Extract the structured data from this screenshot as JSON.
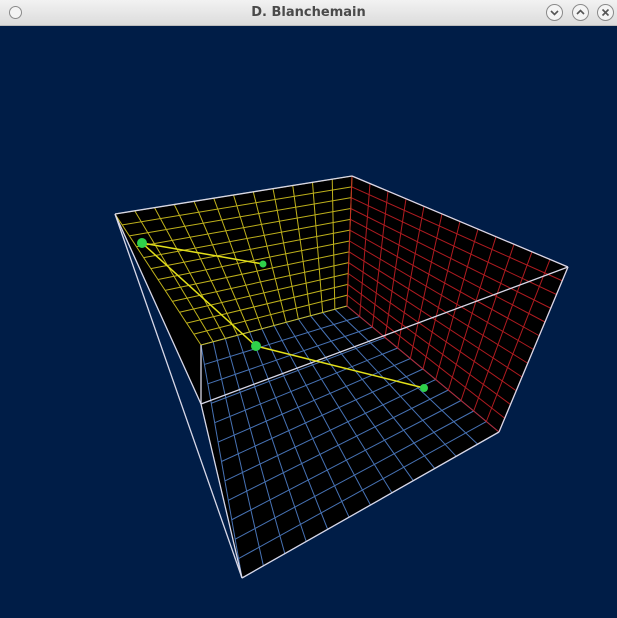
{
  "window": {
    "title": "D. Blanchemain",
    "buttons": [
      "window-menu",
      "minimize",
      "maximize",
      "close"
    ]
  },
  "scene": {
    "background": "#001d47",
    "floor_grid_color": "#4f7fc8",
    "left_wall_grid_color": "#d4c51f",
    "back_wall_grid_color": "#c21f24",
    "edge_color": "#d8d8e8",
    "point_color": "#2fd14a",
    "line_color": "#e3e01a"
  }
}
